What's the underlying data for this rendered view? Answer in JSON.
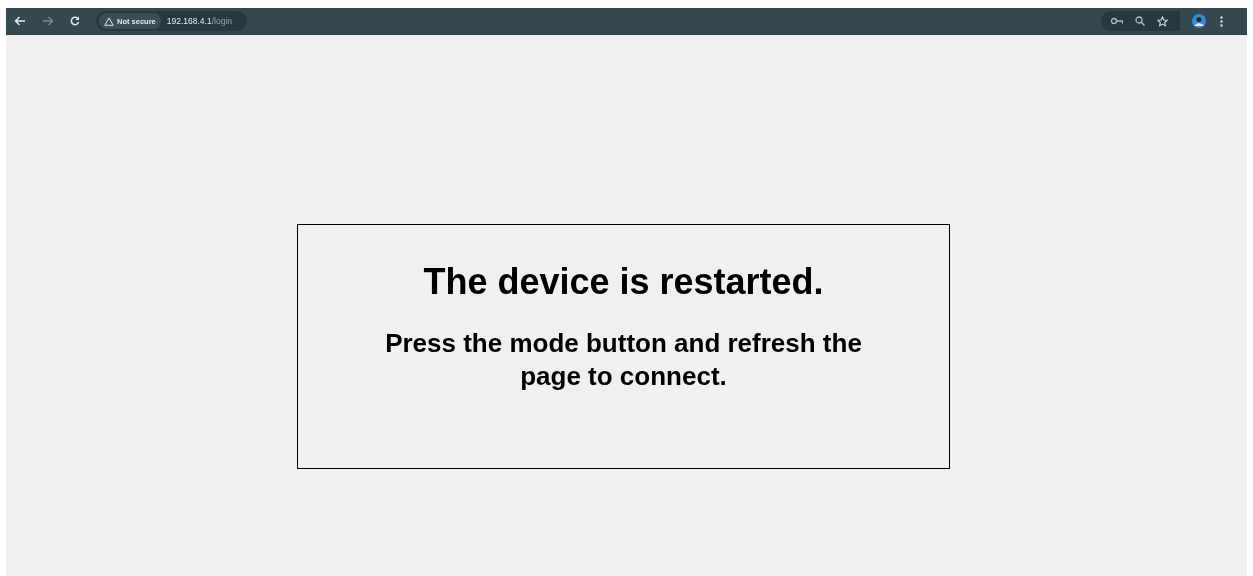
{
  "browser": {
    "security_label": "Not secure",
    "url_host": "192.168.4.1",
    "url_path": "/login"
  },
  "dialog": {
    "title": "The device is restarted.",
    "message": "Press the mode button and refresh the page to connect."
  }
}
